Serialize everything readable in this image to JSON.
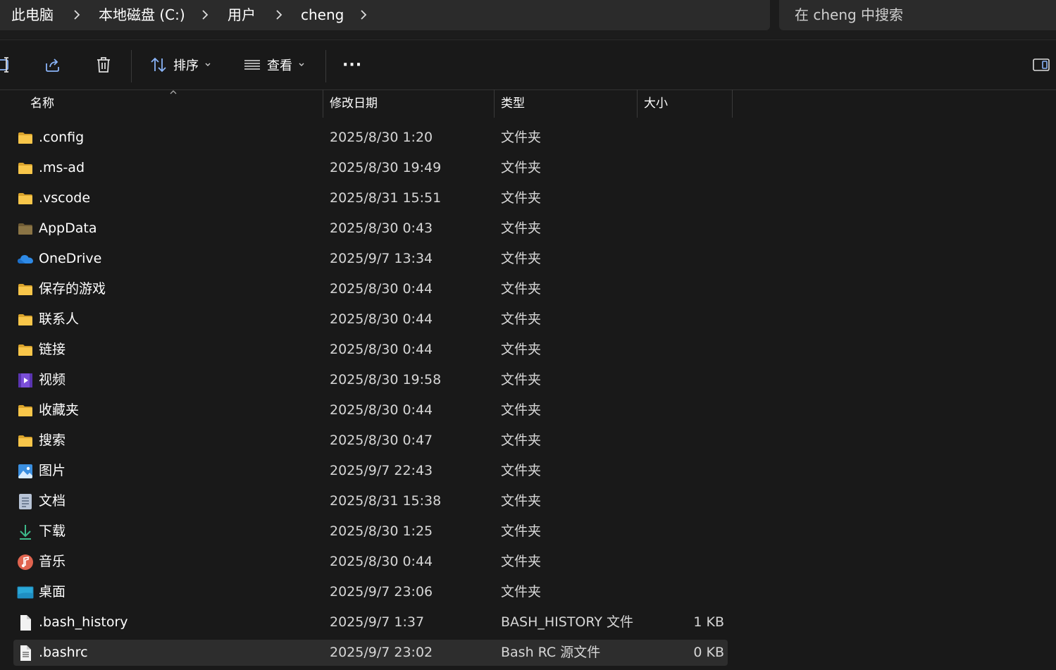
{
  "breadcrumb": [
    "此电脑",
    "本地磁盘 (C:)",
    "用户",
    "cheng"
  ],
  "search": {
    "placeholder": "在 cheng 中搜索"
  },
  "toolbar": {
    "sort_label": "排序",
    "view_label": "查看",
    "more_label": "···"
  },
  "columns": {
    "name": "名称",
    "date": "修改日期",
    "type": "类型",
    "size": "大小"
  },
  "files": [
    {
      "name": ".config",
      "date": "2025/8/30 1:20",
      "type": "文件夹",
      "size": "",
      "icon": "folder-icon"
    },
    {
      "name": ".ms-ad",
      "date": "2025/8/30 19:49",
      "type": "文件夹",
      "size": "",
      "icon": "folder-icon"
    },
    {
      "name": ".vscode",
      "date": "2025/8/31 15:51",
      "type": "文件夹",
      "size": "",
      "icon": "folder-icon"
    },
    {
      "name": "AppData",
      "date": "2025/8/30 0:43",
      "type": "文件夹",
      "size": "",
      "icon": "hidden-folder-icon"
    },
    {
      "name": "OneDrive",
      "date": "2025/9/7 13:34",
      "type": "文件夹",
      "size": "",
      "icon": "onedrive-cloud-icon"
    },
    {
      "name": "保存的游戏",
      "date": "2025/8/30 0:44",
      "type": "文件夹",
      "size": "",
      "icon": "folder-icon"
    },
    {
      "name": "联系人",
      "date": "2025/8/30 0:44",
      "type": "文件夹",
      "size": "",
      "icon": "folder-icon"
    },
    {
      "name": "链接",
      "date": "2025/8/30 0:44",
      "type": "文件夹",
      "size": "",
      "icon": "folder-icon"
    },
    {
      "name": "视频",
      "date": "2025/8/30 19:58",
      "type": "文件夹",
      "size": "",
      "icon": "videos-icon"
    },
    {
      "name": "收藏夹",
      "date": "2025/8/30 0:44",
      "type": "文件夹",
      "size": "",
      "icon": "folder-icon"
    },
    {
      "name": "搜索",
      "date": "2025/8/30 0:47",
      "type": "文件夹",
      "size": "",
      "icon": "folder-icon"
    },
    {
      "name": "图片",
      "date": "2025/9/7 22:43",
      "type": "文件夹",
      "size": "",
      "icon": "pictures-icon"
    },
    {
      "name": "文档",
      "date": "2025/8/31 15:38",
      "type": "文件夹",
      "size": "",
      "icon": "documents-icon"
    },
    {
      "name": "下载",
      "date": "2025/8/30 1:25",
      "type": "文件夹",
      "size": "",
      "icon": "download-icon"
    },
    {
      "name": "音乐",
      "date": "2025/8/30 0:44",
      "type": "文件夹",
      "size": "",
      "icon": "music-icon"
    },
    {
      "name": "桌面",
      "date": "2025/9/7 23:06",
      "type": "文件夹",
      "size": "",
      "icon": "desktop-icon"
    },
    {
      "name": ".bash_history",
      "date": "2025/9/7 1:37",
      "type": "BASH_HISTORY 文件",
      "size": "1 KB",
      "icon": "file-icon"
    },
    {
      "name": ".bashrc",
      "date": "2025/9/7 23:02",
      "type": "Bash RC 源文件",
      "size": "0 KB",
      "icon": "text-file-icon",
      "selected": true
    }
  ],
  "colors": {
    "background": "#191919",
    "bar": "#2b2b2b",
    "folder": "#f8c64a",
    "selected_row": "#2d2d2d"
  }
}
